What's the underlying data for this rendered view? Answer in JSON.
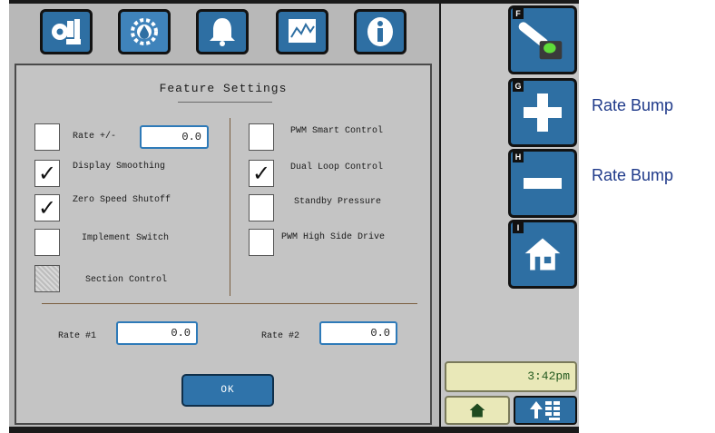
{
  "tabs": [
    {
      "name": "machine-settings",
      "icon": "gear-settings-icon"
    },
    {
      "name": "product-settings",
      "icon": "gear-droplet-icon"
    },
    {
      "name": "alarms",
      "icon": "bell-icon"
    },
    {
      "name": "performance",
      "icon": "chart-monitor-icon"
    },
    {
      "name": "information",
      "icon": "info-icon"
    }
  ],
  "dialog": {
    "title": "Feature Settings",
    "left_options": [
      {
        "label": "Rate +/-",
        "checked": false,
        "value": "0.0"
      },
      {
        "label": "Display Smoothing",
        "checked": true
      },
      {
        "label": "Zero Speed Shutoff",
        "checked": true
      },
      {
        "label": "Implement Switch",
        "checked": false
      },
      {
        "label": "Section Control",
        "checked": false,
        "disabled": true
      }
    ],
    "right_options": [
      {
        "label": "PWM Smart Control",
        "checked": false
      },
      {
        "label": "Dual Loop Control",
        "checked": true
      },
      {
        "label": "Standby Pressure",
        "checked": false
      },
      {
        "label": "PWM High Side Drive",
        "checked": false
      }
    ],
    "rate1": {
      "label": "Rate #1",
      "value": "0.0"
    },
    "rate2": {
      "label": "Rate #2",
      "value": "0.0"
    },
    "ok_label": "OK"
  },
  "side_buttons": [
    {
      "key": "F",
      "icon": "tap-faucet-icon"
    },
    {
      "key": "G",
      "icon": "plus-icon"
    },
    {
      "key": "H",
      "icon": "minus-icon"
    },
    {
      "key": "I",
      "icon": "home-icon"
    }
  ],
  "clock": "3:42pm",
  "external_labels": [
    "Rate Bump",
    "Rate Bump"
  ],
  "colors": {
    "button_blue": "#2e6fa3",
    "panel_gray": "#b8b8b8",
    "clock_bg": "#e9e8b8",
    "check_mark": "✓"
  }
}
